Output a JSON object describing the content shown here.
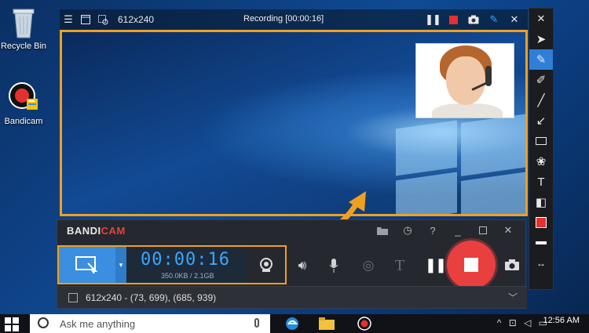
{
  "desktop": {
    "icons": [
      {
        "label": "Recycle Bin",
        "icon": "recycle-bin-icon"
      },
      {
        "label": "Bandicam",
        "icon": "bandicam-app-icon"
      }
    ]
  },
  "recording_window": {
    "size_label": "612x240",
    "status": "Recording [00:00:16]",
    "icons": [
      "menu-icon",
      "window-icon",
      "screen-select-icon",
      "pause-icon",
      "stop-icon",
      "camera-icon",
      "pencil-icon",
      "close-icon"
    ]
  },
  "draw_toolbar": {
    "tools": [
      "cursor-icon",
      "pencil-icon",
      "marker-icon",
      "line-icon",
      "arrow-icon",
      "rectangle-icon",
      "numbering-icon",
      "text-icon",
      "eraser-icon",
      "color-red-swatch",
      "line-width-icon",
      "expand-icon"
    ],
    "active_tool": "pencil-icon",
    "colors": {
      "accent": "#2f7fd8",
      "selected_color": "#e53030"
    }
  },
  "bandicam": {
    "logo_part1": "BANDI",
    "logo_part2": "CAM",
    "timer": "00:00:16",
    "size_info": "350.0KB / 2.1GB",
    "footer_text": "612x240 - (73, 699), (685, 939)",
    "header_icons": [
      "folder-icon",
      "clock-icon",
      "help-icon",
      "minimize-icon",
      "maximize-icon",
      "close-icon"
    ],
    "colors": {
      "mode_blue": "#3a8fe0",
      "timer_blue": "#3aa6ff",
      "record_red": "#ea3f3f",
      "highlight_orange": "#f0a020"
    }
  },
  "taskbar": {
    "search_placeholder": "Ask me anything",
    "clock_time": "12:56 AM",
    "apps": [
      "edge-icon",
      "file-explorer-icon",
      "bandicam-taskbar-icon"
    ]
  }
}
